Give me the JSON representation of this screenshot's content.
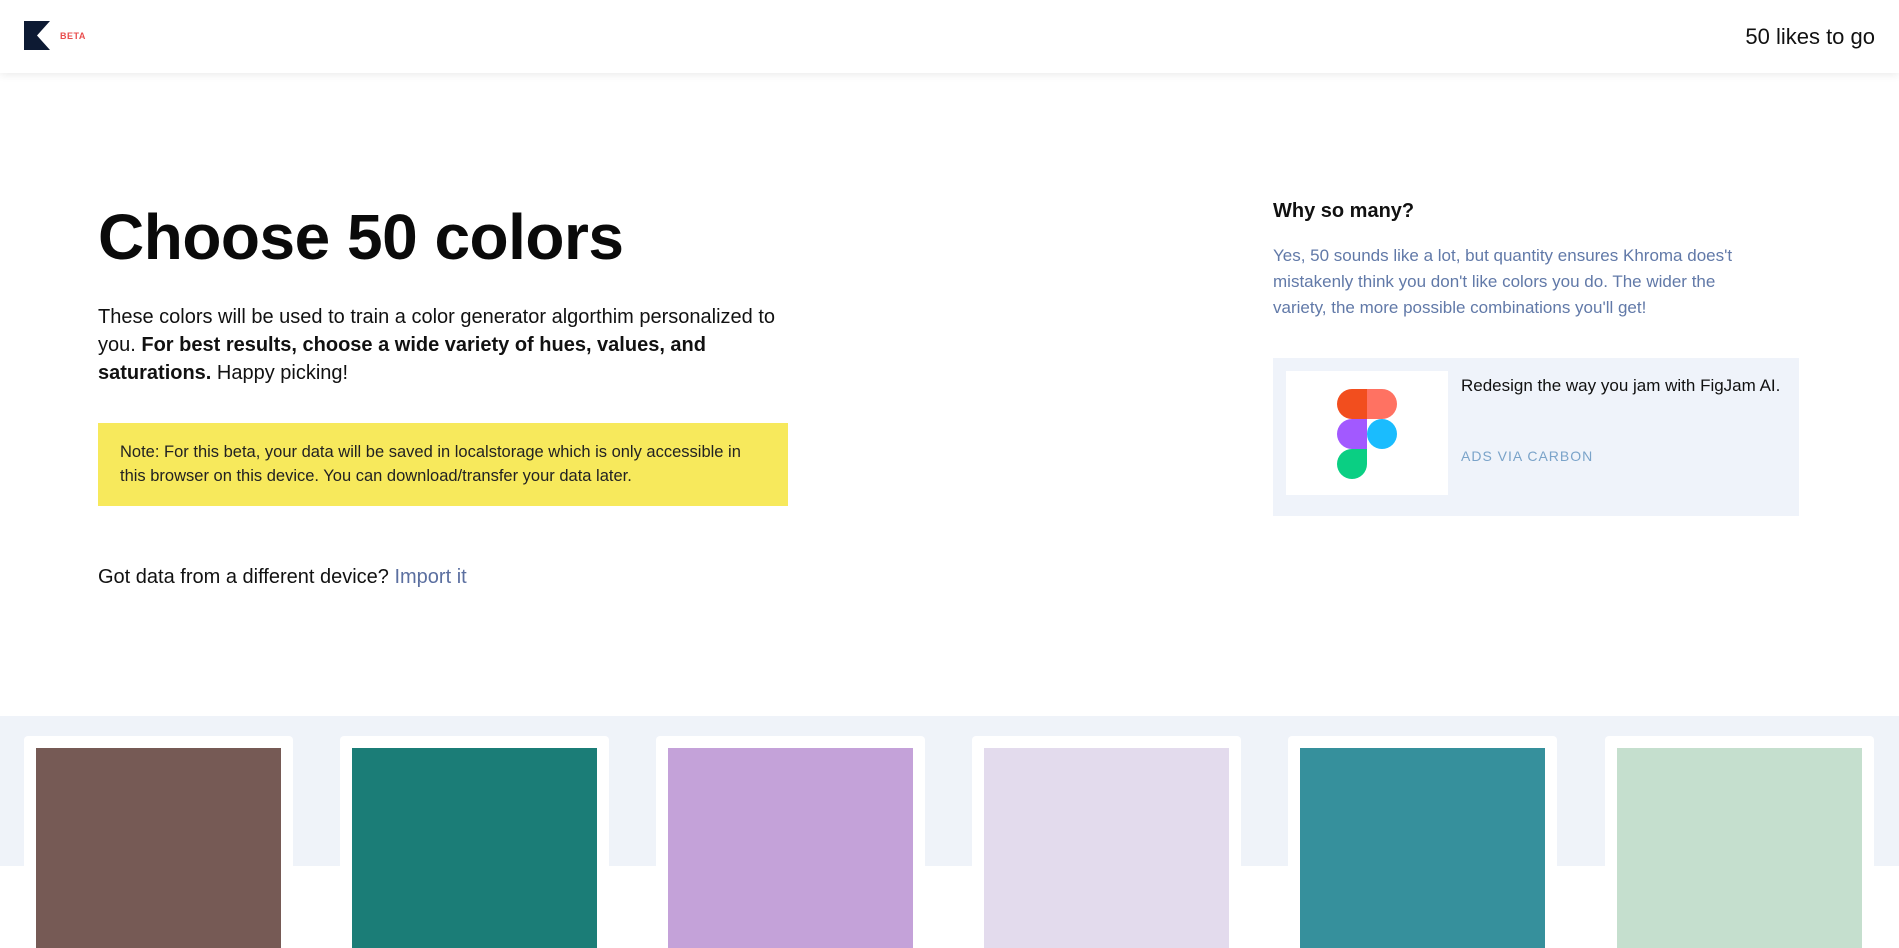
{
  "header": {
    "beta_label": "BETA",
    "likes_to_go": "50 likes to go"
  },
  "intro": {
    "title": "Choose 50 colors",
    "description_start": "These colors will be used to train a color generator algorthim personalized to you. ",
    "description_bold": "For best results, choose a wide variety of hues, values, and saturations.",
    "description_end": " Happy picking!",
    "note": "Note: For this beta, your data will be saved in localstorage which is only accessible in this browser on this device. You can download/transfer your data later.",
    "import_prompt": "Got data from a different device? ",
    "import_link": "Import it"
  },
  "sidebar": {
    "why_title": "Why so many?",
    "why_body": "Yes, 50 sounds like a lot, but quantity ensures Khroma does't mistakenly think you don't like colors you do. The wider the variety, the more possible combinations you'll get!",
    "ad": {
      "text": "Redesign the way you jam with FigJam AI.",
      "via": "ADS VIA CARBON",
      "image_icon": "figma-logo-icon"
    }
  },
  "swatches": [
    "#765a55",
    "#1b7d77",
    "#c4a2d9",
    "#e3dbed",
    "#36909c",
    "#c5dfce"
  ],
  "colors": {
    "accent_link": "#5b6fa0",
    "note_background": "#f7e95c",
    "beta_red": "#e94e4e",
    "logo_navy": "#0d1a33",
    "sidebar_text": "#6179a8",
    "ad_background": "#eff3fa"
  }
}
